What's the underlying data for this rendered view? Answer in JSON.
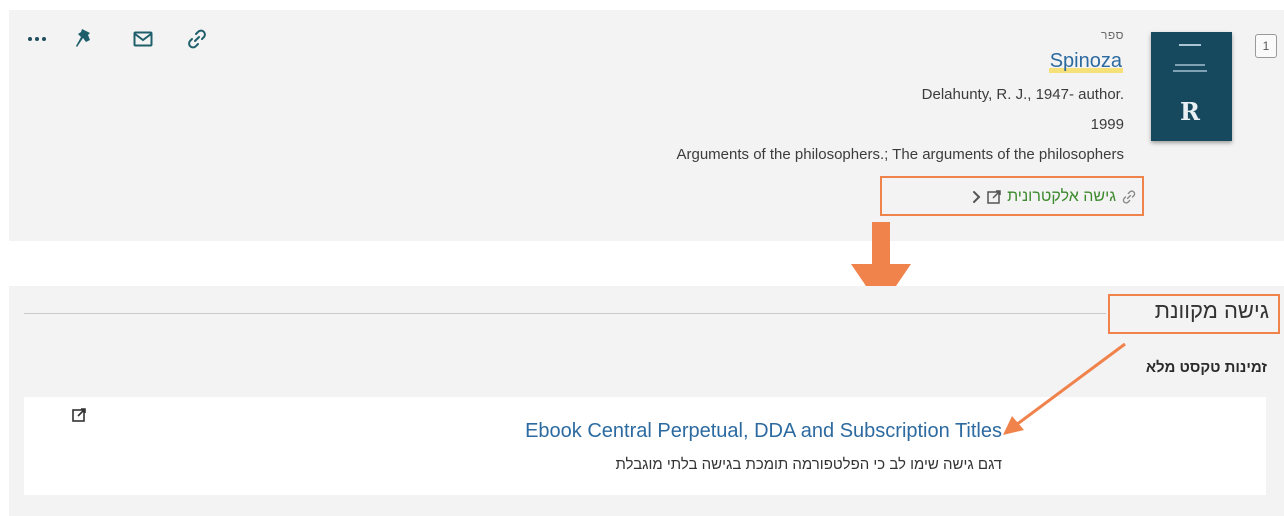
{
  "record": {
    "index": "1",
    "type": "ספר",
    "title": "Spinoza",
    "author": "Delahunty, R. J., 1947- author.",
    "year": "1999",
    "series": "Arguments of the philosophers.; The arguments of the philosophers",
    "access_link": "גישה אלקטרונית"
  },
  "actions": [
    {
      "name": "more-actions",
      "icon": "ellipsis-icon"
    },
    {
      "name": "pin",
      "icon": "pushpin-icon"
    },
    {
      "name": "email",
      "icon": "envelope-icon"
    },
    {
      "name": "permalink",
      "icon": "link-icon"
    }
  ],
  "online_access": {
    "section_title": "גישה מקוונת",
    "availability_label": "זמינות טקסט מלא",
    "service": {
      "title": "Ebook Central Perpetual, DDA and Subscription Titles",
      "note": "דגם גישה שימו לב כי הפלטפורמה תומכת בגישה בלתי מוגבלת"
    }
  },
  "colors": {
    "annotation": "#f0824b",
    "link_blue": "#2c6aa0",
    "access_green": "#3d8a2e",
    "title_highlight": "#f5e07a",
    "icon_teal": "#1f5f6b"
  }
}
